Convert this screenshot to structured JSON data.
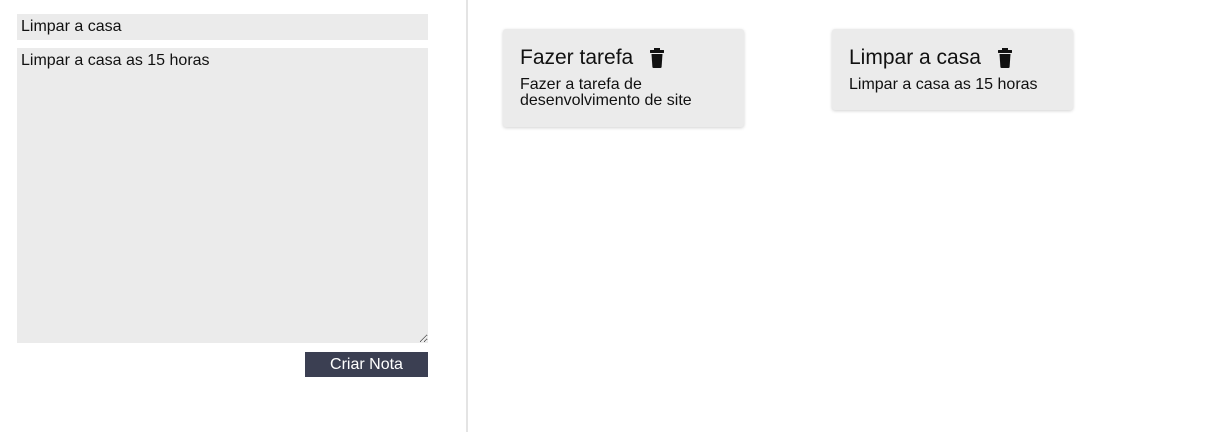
{
  "form": {
    "title_value": "Limpar a casa",
    "body_value": "Limpar a casa as 15 horas",
    "submit_label": "Criar Nota"
  },
  "notes": [
    {
      "title": "Fazer tarefa",
      "body": "Fazer a tarefa de desenvolvimento de site",
      "delete_icon": "trash-icon"
    },
    {
      "title": "Limpar a casa",
      "body": "Limpar a casa as 15 horas",
      "delete_icon": "trash-icon"
    }
  ],
  "colors": {
    "field_bg": "#ebebeb",
    "button_bg": "#3b3f52",
    "button_text": "#ffffff",
    "card_bg": "#ebebeb",
    "divider": "#e4e4e4"
  }
}
